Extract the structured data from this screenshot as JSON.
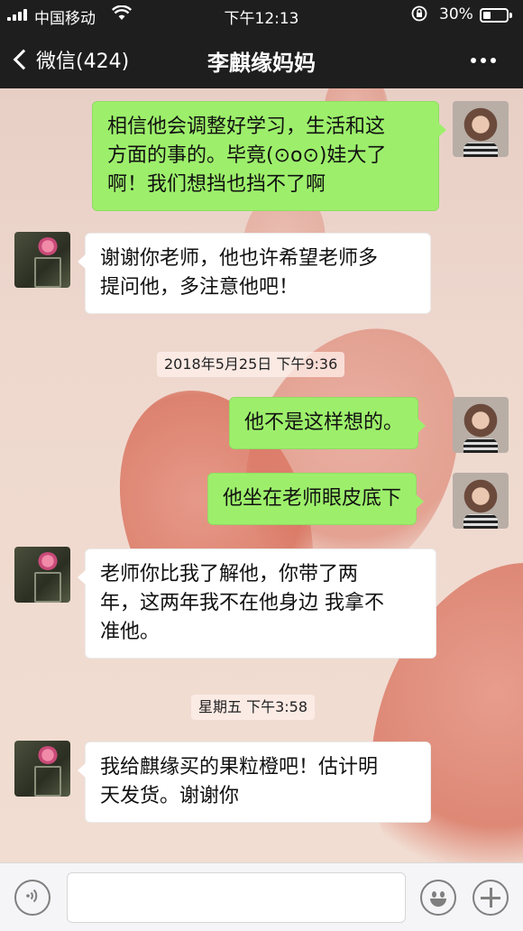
{
  "status_bar": {
    "carrier": "中国移动",
    "time": "下午12:13",
    "battery_percent": "30%",
    "battery_level": 0.3
  },
  "nav": {
    "back_label": "微信(424)",
    "title": "李麒缘妈妈"
  },
  "messages": [
    {
      "side": "out",
      "sender": "teacher",
      "lines": [
        "相信他会调整好学习，生活和这",
        "方面的事的。毕竟(⊙o⊙)娃大了",
        "啊！我们想挡也挡不了啊"
      ]
    },
    {
      "side": "in",
      "sender": "parent",
      "lines": [
        "谢谢你老师，他也许希望老师多",
        "提问他，多注意他吧！"
      ]
    },
    {
      "timestamp": "2018年5月25日 下午9:36"
    },
    {
      "side": "out",
      "sender": "teacher",
      "lines": [
        "他不是这样想的。"
      ]
    },
    {
      "side": "out",
      "sender": "teacher",
      "lines": [
        "他坐在老师眼皮底下"
      ]
    },
    {
      "side": "in",
      "sender": "parent",
      "lines": [
        "老师你比我了解他，你带了两",
        "年，这两年我不在他身边 我拿不",
        "准他。"
      ]
    },
    {
      "timestamp": "星期五 下午3:58"
    },
    {
      "side": "in",
      "sender": "parent",
      "lines": [
        "我给麒缘买的果粒橙吧！估计明",
        "天发货。谢谢你"
      ]
    }
  ],
  "input_bar": {
    "voice_icon": "voice-icon",
    "emoji_icon": "emoji-icon",
    "plus_icon": "plus-icon",
    "text_value": ""
  },
  "colors": {
    "outgoing_bubble": "#9def6b",
    "incoming_bubble": "#ffffff",
    "nav_background": "#1e1e1e"
  }
}
